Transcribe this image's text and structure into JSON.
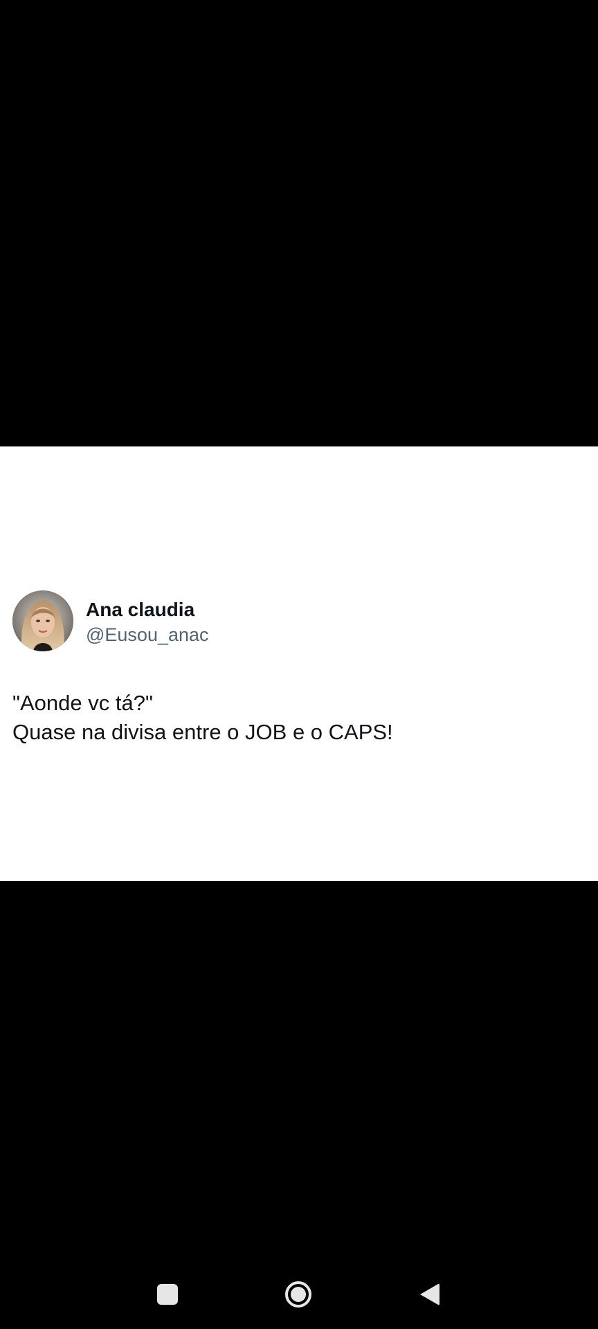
{
  "tweet": {
    "display_name": "Ana claudia",
    "handle": "@Eusou_anac",
    "avatar_icon": "profile-photo",
    "lines": [
      "\"Aonde vc tá?\"",
      "Quase na divisa entre o JOB e o CAPS!"
    ]
  },
  "nav_bar": {
    "buttons": [
      {
        "icon": "recents-square-icon"
      },
      {
        "icon": "home-circle-icon"
      },
      {
        "icon": "back-triangle-icon"
      }
    ]
  },
  "colors": {
    "background": "#000000",
    "card": "#ffffff",
    "name_text": "#0f1419",
    "handle_text": "#536471",
    "nav_icons": "#e6e6e6"
  }
}
